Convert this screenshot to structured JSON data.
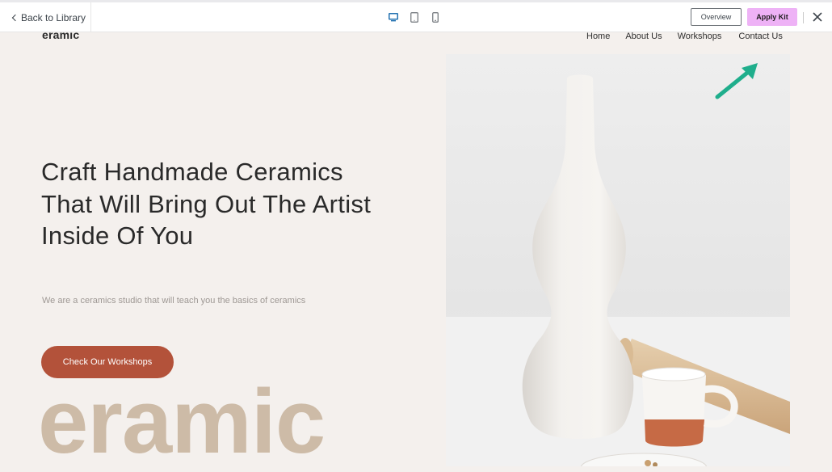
{
  "toolbar": {
    "back_label": "Back to Library",
    "devices": [
      "desktop-icon",
      "tablet-icon",
      "mobile-icon"
    ],
    "overview_label": "Overview",
    "apply_label": "Apply Kit"
  },
  "site": {
    "logo": "eramic",
    "nav": [
      "Home",
      "About Us",
      "Workshops",
      "Contact Us"
    ],
    "headline": "Craft Handmade Ceramics That Will Bring Out The Artist Inside Of You",
    "subtext": "We are a ceramics studio that will teach you the basics of ceramics",
    "cta_label": "Check Our Workshops",
    "big_word": "eramic"
  },
  "colors": {
    "apply_button": "#eeb2f6",
    "cta": "#b3523a",
    "page_bg": "#f4f0ed",
    "big_word": "#cdbba7",
    "arrow": "#1fae8c",
    "device_active": "#2271b1"
  }
}
